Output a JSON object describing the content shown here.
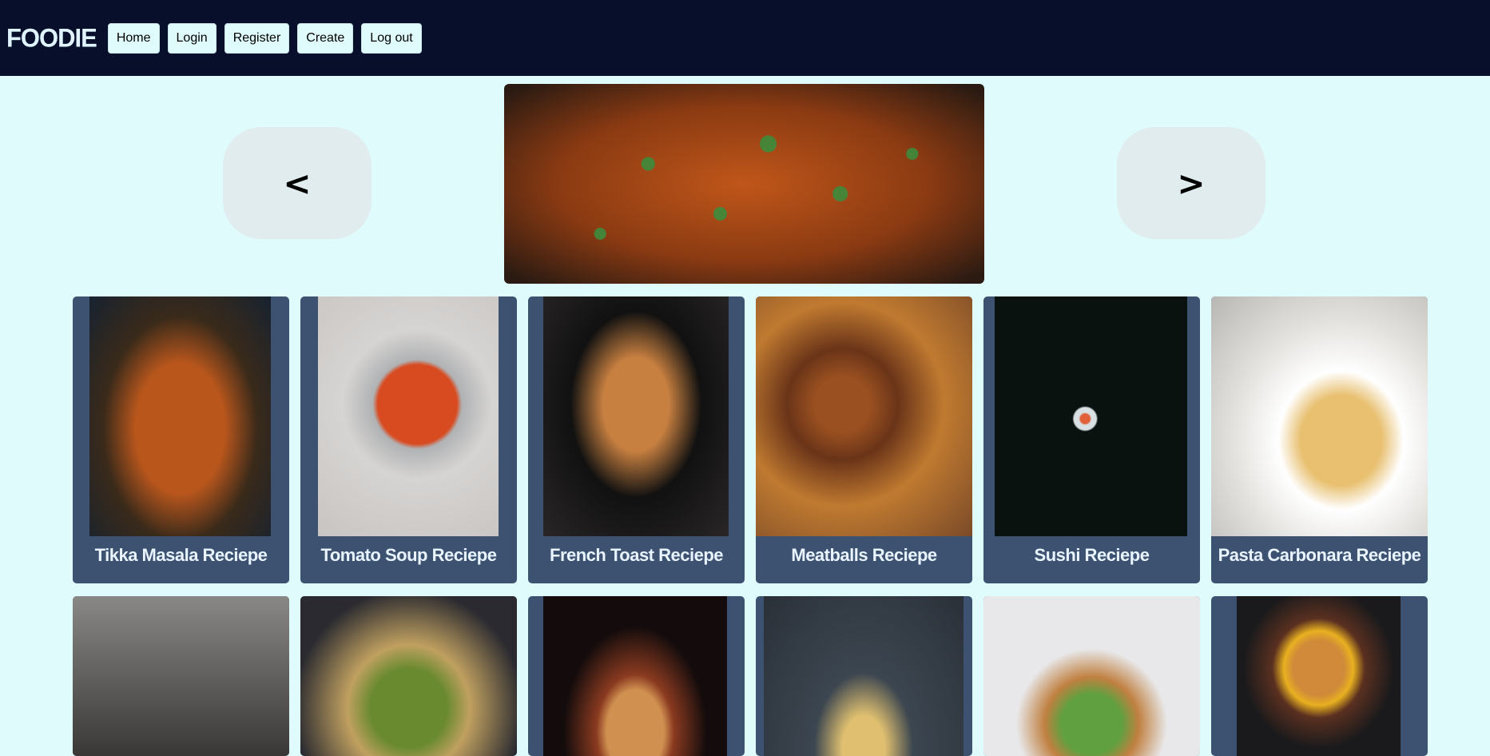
{
  "header": {
    "brand": "FOODIE",
    "nav": [
      {
        "label": "Home"
      },
      {
        "label": "Login"
      },
      {
        "label": "Register"
      },
      {
        "label": "Create"
      },
      {
        "label": "Log out"
      }
    ]
  },
  "carousel": {
    "prev_label": "<",
    "next_label": ">",
    "image_icon": "tikka-masala-photo"
  },
  "recipes_row1": [
    {
      "title": "Tikka Masala Reciepe",
      "color": "#1c2c3c"
    },
    {
      "title": "Tomato Soup Reciepe",
      "color": "#c8c4c2"
    },
    {
      "title": "French Toast Reciepe",
      "color": "#2a2628"
    },
    {
      "title": "Meatballs Reciepe",
      "color": "#7a4a28"
    },
    {
      "title": "Sushi Reciepe",
      "color": "#0a1210"
    },
    {
      "title": "Pasta Carbonara Reciepe",
      "color": "#e2e0dc"
    }
  ],
  "recipes_row2": [
    {
      "color": "#8a8886"
    },
    {
      "color": "#2a2a30"
    },
    {
      "color": "#140c0c"
    },
    {
      "color": "#3c4650"
    },
    {
      "color": "#e8e8ea"
    },
    {
      "color": "#1a1a1c"
    }
  ]
}
